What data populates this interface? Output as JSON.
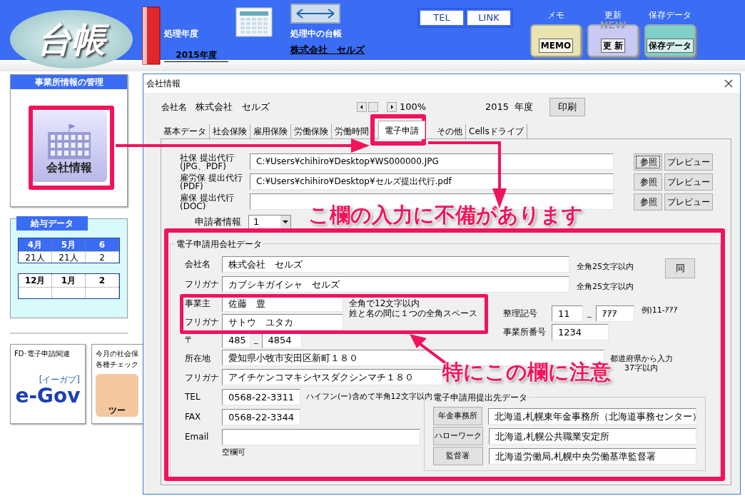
{
  "app_header": {
    "logo": "台帳",
    "year_label": "処理年度",
    "year": "2015年度",
    "ledger_label": "処理中の台帳",
    "ledger": "株式会社　セルズ",
    "buttons": [
      "TEL",
      "LINK"
    ],
    "tools": [
      {
        "kind": "memo",
        "caption": "メモ",
        "icon_text": "MEMO"
      },
      {
        "kind": "update",
        "caption": "更新",
        "icon_badge": "NEW",
        "icon_text": "更 新"
      },
      {
        "kind": "save",
        "caption": "保存データ",
        "icon_text": "保存データ"
      }
    ]
  },
  "office_panel": {
    "title": "事業所情報の管理",
    "button": "会社情報"
  },
  "payroll": {
    "title": "給与データ",
    "tables": [
      {
        "months": [
          "4月",
          "5月",
          "6"
        ],
        "counts": [
          "21人",
          "21人",
          "2"
        ]
      },
      {
        "months": [
          "12月",
          "1月",
          "2"
        ]
      }
    ]
  },
  "tiles": [
    {
      "kind": "egov",
      "lines": [
        "FD･電子申請関連"
      ],
      "logo": "e-Gov",
      "logo_sub": "[イーガブ]"
    },
    {
      "kind": "tools",
      "lines": [
        "今月の社会保",
        "各種チェック"
      ],
      "icon_text": "ツー"
    }
  ],
  "dialog": {
    "title": "会社情報",
    "company_label": "会社名",
    "company": "株式会社　セルズ",
    "zoom": "100%",
    "year": "2015  年度",
    "print_button": "印刷",
    "tabs": [
      {
        "label": "基本データ",
        "selected": false
      },
      {
        "label": "社会保険",
        "selected": false
      },
      {
        "label": "雇用保険",
        "selected": false
      },
      {
        "label": "労働保険",
        "selected": false
      },
      {
        "label": "労働時間",
        "selected": false
      },
      {
        "label": "電子申請",
        "selected": true
      },
      {
        "label": "その他",
        "selected": false
      },
      {
        "label": "Cellsドライブ",
        "selected": false
      }
    ],
    "files": [
      {
        "label": "社保 提出代行",
        "sub": "(JPG、PDF)",
        "value": "C:¥Users¥chihiro¥Desktop¥WS000000.JPG",
        "browse": "参照",
        "preview": "プレビュー",
        "focused": true
      },
      {
        "label": "雇労保 提出代行",
        "sub": "(PDF)",
        "value": "C:¥Users¥chihiro¥Desktop¥セルズ提出代行.pdf",
        "browse": "参照",
        "preview": "プレビュー",
        "focused": false
      },
      {
        "label": "雇保 提出代行",
        "sub": "(DOC)",
        "browse": "参照",
        "preview": "プレビュー",
        "focused": false
      }
    ],
    "applicant": {
      "label": "申請者情報",
      "value": "1"
    },
    "company_data": {
      "title": "電子申請用会社データ",
      "name_label": "会社名",
      "name": "株式会社　セルズ",
      "name_note": "全角25文字以内",
      "same_button": "同",
      "kana_label": "フリガナ",
      "kana": "カブシキガイシャ　セルズ",
      "kana_note": "全角25文字以内",
      "owner_label": "事業主",
      "owner": "佐藤　豊",
      "owner_kana_label": "フリガナ",
      "owner_kana": "サトウ　ユタカ",
      "owner_notes": [
        "全角で12文字以内",
        "姓と名の間に１つの全角スペース"
      ],
      "zip_label": "〒",
      "zip1": "485",
      "zip_sep": "_",
      "zip2": "4854",
      "ref_label": "整理記号",
      "ref1": "11",
      "ref_sep": "_",
      "ref2": "ｱｱｱ",
      "ref_note": "例)11-ｱｱｱ",
      "office_no_label": "事業所番号",
      "office_no": "1234",
      "address_label": "所在地",
      "address": "愛知県小牧市安田区新町１８０",
      "address_notes": [
        "都道府県から入力",
        "37字以内"
      ],
      "address_kana_label": "フリガナ",
      "address_kana": "アイチケンコマキシヤスダクシンマチ１８０",
      "tel_label": "TEL",
      "tel": "0568-22-3311",
      "tel_note": "ハイフン(ー)含めて半角12文字以内",
      "fax_label": "FAX",
      "fax": "0568-22-3344",
      "email_label": "Email",
      "email_note": "空欄可"
    },
    "offices": {
      "title": "電子申請用提出先データ",
      "rows": [
        {
          "button": "年金事務所",
          "value": "北海道,札幌東年金事務所（北海道事務センター）"
        },
        {
          "button": "ハローワーク",
          "value": "北海道,札幌公共職業安定所"
        },
        {
          "button": "監督署",
          "value": "北海道労働局,札幌中央労働基準監督署"
        }
      ]
    }
  },
  "annotations": [
    {
      "kind": "callout",
      "text": "こ欄の入力に不備があります"
    },
    {
      "kind": "callout",
      "text": "特にこの欄に注意"
    }
  ]
}
